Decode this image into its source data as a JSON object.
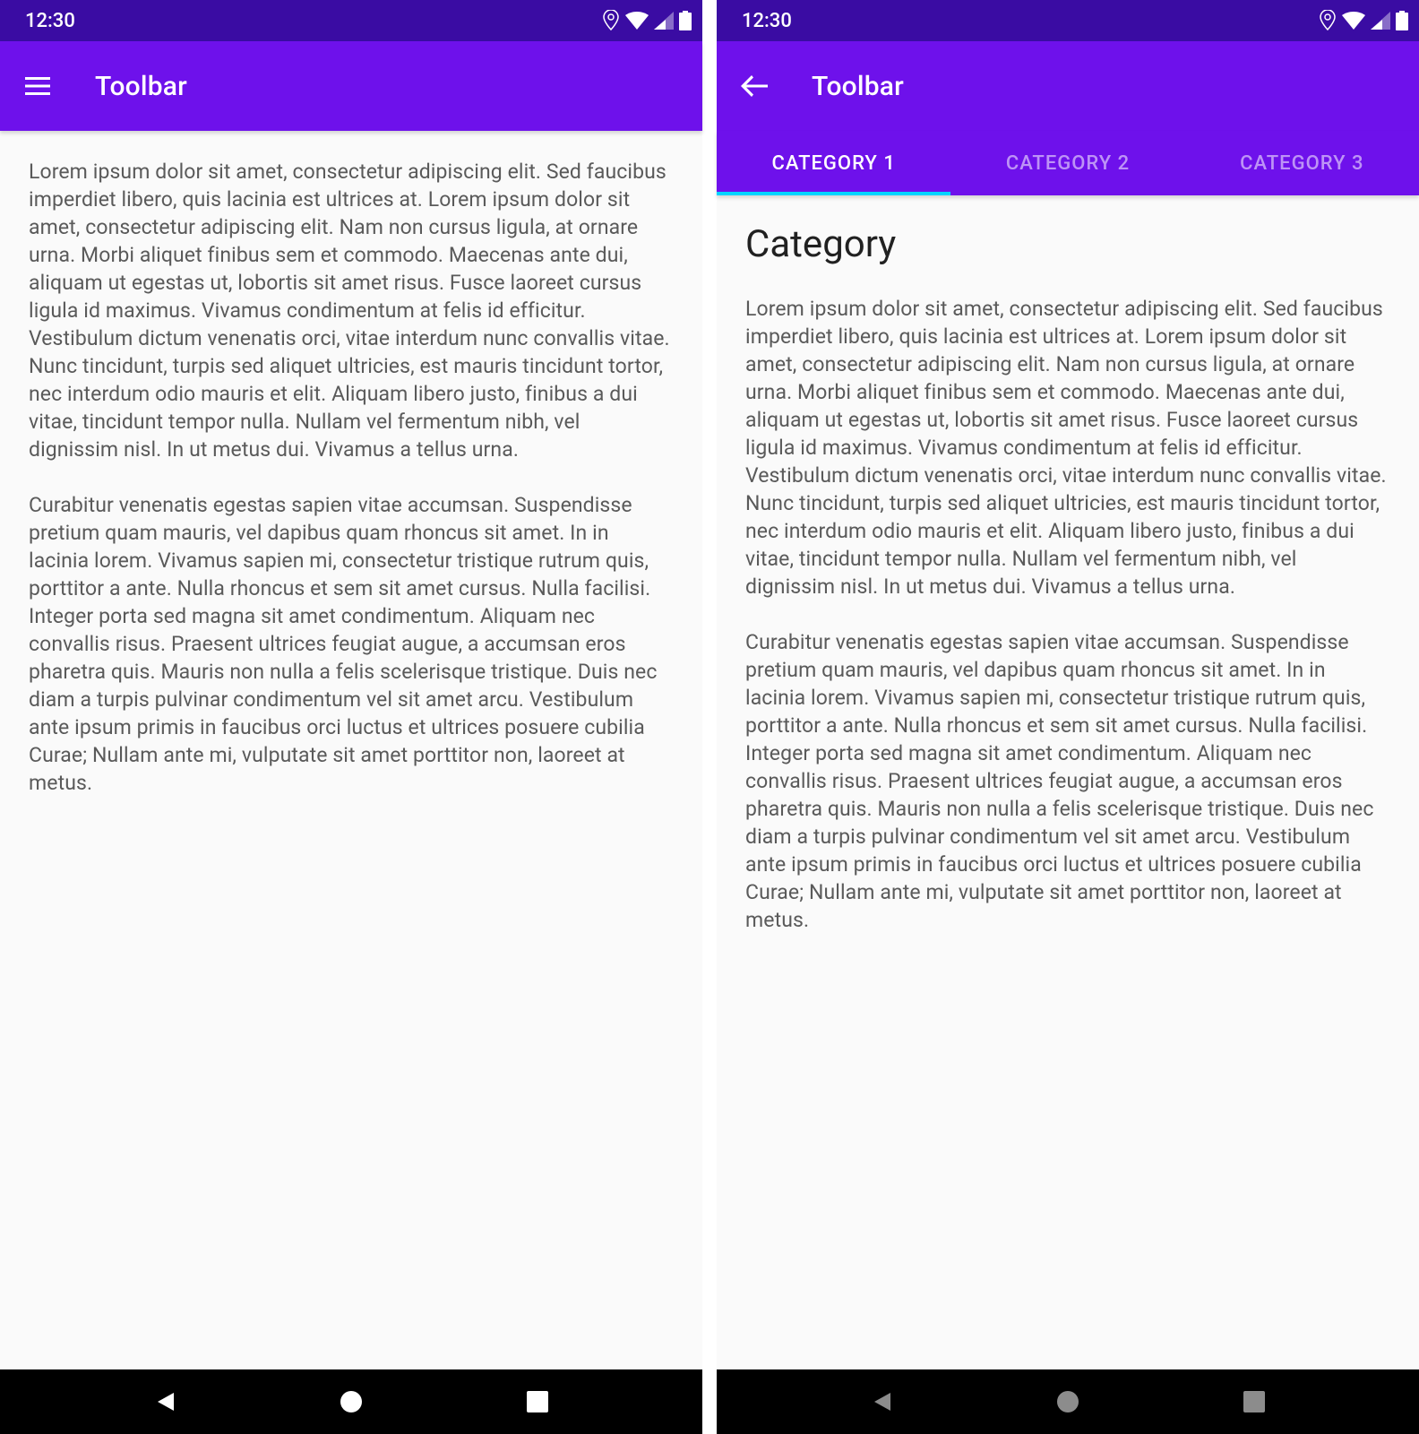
{
  "colors": {
    "status_bar": "#3a0ca3",
    "app_bar": "#6e11eb",
    "tab_indicator": "#00d4ff"
  },
  "status": {
    "time": "12:30"
  },
  "screen1": {
    "toolbar_title": "Toolbar",
    "paragraph1": "Lorem ipsum dolor sit amet, consectetur adipiscing elit. Sed faucibus imperdiet libero, quis lacinia est ultrices at. Lorem ipsum dolor sit amet, consectetur adipiscing elit. Nam non cursus ligula, at ornare urna. Morbi aliquet finibus sem et commodo. Maecenas ante dui, aliquam ut egestas ut, lobortis sit amet risus. Fusce laoreet cursus ligula id maximus. Vivamus condimentum at felis id efficitur. Vestibulum dictum venenatis orci, vitae interdum nunc convallis vitae. Nunc tincidunt, turpis sed aliquet ultricies, est mauris tincidunt tortor, nec interdum odio mauris et elit. Aliquam libero justo, finibus a dui vitae, tincidunt tempor nulla. Nullam vel fermentum nibh, vel dignissim nisl. In ut metus dui. Vivamus a tellus urna.",
    "paragraph2": "Curabitur venenatis egestas sapien vitae accumsan. Suspendisse pretium quam mauris, vel dapibus quam rhoncus sit amet. In in lacinia lorem. Vivamus sapien mi, consectetur tristique rutrum quis, porttitor a ante. Nulla rhoncus et sem sit amet cursus. Nulla facilisi. Integer porta sed magna sit amet condimentum. Aliquam nec convallis risus. Praesent ultrices feugiat augue, a accumsan eros pharetra quis. Mauris non nulla a felis scelerisque tristique. Duis nec diam a turpis pulvinar condimentum vel sit amet arcu. Vestibulum ante ipsum primis in faucibus orci luctus et ultrices posuere cubilia Curae; Nullam ante mi, vulputate sit amet porttitor non, laoreet at metus."
  },
  "screen2": {
    "toolbar_title": "Toolbar",
    "tabs": {
      "tab1": "CATEGORY 1",
      "tab2": "CATEGORY 2",
      "tab3": "CATEGORY 3"
    },
    "heading": "Category",
    "paragraph1": "Lorem ipsum dolor sit amet, consectetur adipiscing elit. Sed faucibus imperdiet libero, quis lacinia est ultrices at. Lorem ipsum dolor sit amet, consectetur adipiscing elit. Nam non cursus ligula, at ornare urna. Morbi aliquet finibus sem et commodo. Maecenas ante dui, aliquam ut egestas ut, lobortis sit amet risus. Fusce laoreet cursus ligula id maximus. Vivamus condimentum at felis id efficitur. Vestibulum dictum venenatis orci, vitae interdum nunc convallis vitae. Nunc tincidunt, turpis sed aliquet ultricies, est mauris tincidunt tortor, nec interdum odio mauris et elit. Aliquam libero justo, finibus a dui vitae, tincidunt tempor nulla. Nullam vel fermentum nibh, vel dignissim nisl. In ut metus dui. Vivamus a tellus urna.",
    "paragraph2": "Curabitur venenatis egestas sapien vitae accumsan. Suspendisse pretium quam mauris, vel dapibus quam rhoncus sit amet. In in lacinia lorem. Vivamus sapien mi, consectetur tristique rutrum quis, porttitor a ante. Nulla rhoncus et sem sit amet cursus. Nulla facilisi. Integer porta sed magna sit amet condimentum. Aliquam nec convallis risus. Praesent ultrices feugiat augue, a accumsan eros pharetra quis. Mauris non nulla a felis scelerisque tristique. Duis nec diam a turpis pulvinar condimentum vel sit amet arcu. Vestibulum ante ipsum primis in faucibus orci luctus et ultrices posuere cubilia Curae; Nullam ante mi, vulputate sit amet porttitor non, laoreet at metus."
  }
}
